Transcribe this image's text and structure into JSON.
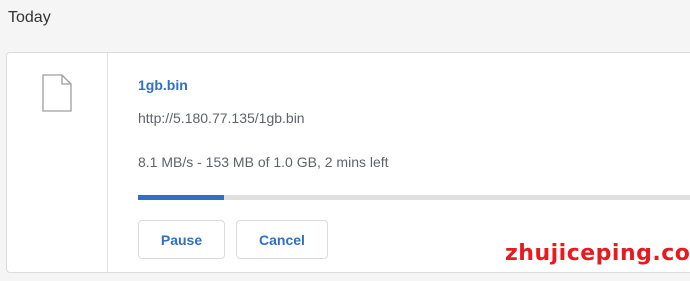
{
  "section": {
    "title": "Today"
  },
  "download": {
    "file_name": "1gb.bin",
    "url": "http://5.180.77.135/1gb.bin",
    "status": "8.1 MB/s - 153 MB of 1.0 GB, 2 mins left",
    "progress_fraction": 0.153,
    "file_icon": "document-icon"
  },
  "buttons": {
    "pause_label": "Pause",
    "cancel_label": "Cancel"
  },
  "watermark": {
    "text": "zhujiceping.com"
  },
  "colors": {
    "accent": "#2f6fc4",
    "watermark": "#e8191f",
    "track": "#e0e0e0"
  }
}
